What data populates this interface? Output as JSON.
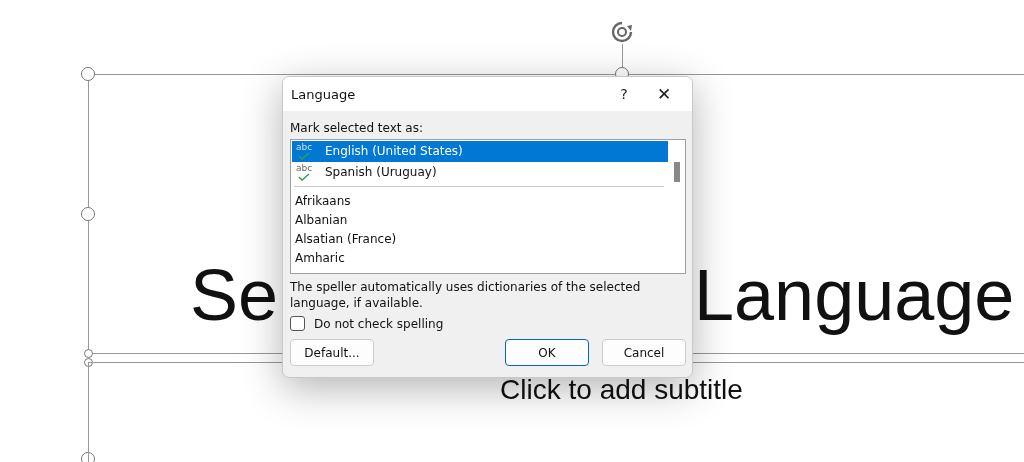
{
  "slide": {
    "title_parts": [
      "Se",
      "Language"
    ],
    "subtitle": "Click to add subtitle"
  },
  "dialog": {
    "title": "Language",
    "help": "?",
    "close": "✕",
    "list_label": "Mark selected text as:",
    "recent": [
      {
        "icon_text": "abc",
        "label": "English (United States)",
        "selected": true
      },
      {
        "icon_text": "abc",
        "label": "Spanish (Uruguay)",
        "selected": false
      }
    ],
    "languages": [
      {
        "label": "Afrikaans",
        "selected": false
      },
      {
        "label": "Albanian",
        "selected": false
      },
      {
        "label": "Alsatian (France)",
        "selected": false
      },
      {
        "label": "Amharic",
        "selected": false
      }
    ],
    "note": "The speller automatically uses dictionaries of the selected language, if available.",
    "no_spellcheck": {
      "label": "Do not check spelling",
      "checked": false
    },
    "buttons": [
      {
        "label": "Default...",
        "kind": "secondary"
      },
      {
        "label": "OK",
        "kind": "primary"
      },
      {
        "label": "Cancel",
        "kind": "secondary"
      }
    ]
  }
}
